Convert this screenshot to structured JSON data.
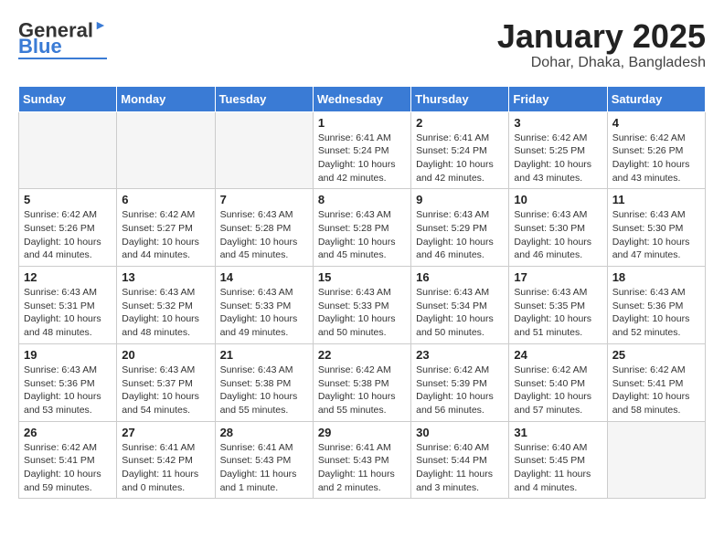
{
  "header": {
    "logo_general": "General",
    "logo_blue": "Blue",
    "month_title": "January 2025",
    "location": "Dohar, Dhaka, Bangladesh"
  },
  "weekdays": [
    "Sunday",
    "Monday",
    "Tuesday",
    "Wednesday",
    "Thursday",
    "Friday",
    "Saturday"
  ],
  "weeks": [
    [
      {
        "day": "",
        "empty": true
      },
      {
        "day": "",
        "empty": true
      },
      {
        "day": "",
        "empty": true
      },
      {
        "day": "1",
        "sunrise": "6:41 AM",
        "sunset": "5:24 PM",
        "daylight": "10 hours and 42 minutes."
      },
      {
        "day": "2",
        "sunrise": "6:41 AM",
        "sunset": "5:24 PM",
        "daylight": "10 hours and 42 minutes."
      },
      {
        "day": "3",
        "sunrise": "6:42 AM",
        "sunset": "5:25 PM",
        "daylight": "10 hours and 43 minutes."
      },
      {
        "day": "4",
        "sunrise": "6:42 AM",
        "sunset": "5:26 PM",
        "daylight": "10 hours and 43 minutes."
      }
    ],
    [
      {
        "day": "5",
        "sunrise": "6:42 AM",
        "sunset": "5:26 PM",
        "daylight": "10 hours and 44 minutes."
      },
      {
        "day": "6",
        "sunrise": "6:42 AM",
        "sunset": "5:27 PM",
        "daylight": "10 hours and 44 minutes."
      },
      {
        "day": "7",
        "sunrise": "6:43 AM",
        "sunset": "5:28 PM",
        "daylight": "10 hours and 45 minutes."
      },
      {
        "day": "8",
        "sunrise": "6:43 AM",
        "sunset": "5:28 PM",
        "daylight": "10 hours and 45 minutes."
      },
      {
        "day": "9",
        "sunrise": "6:43 AM",
        "sunset": "5:29 PM",
        "daylight": "10 hours and 46 minutes."
      },
      {
        "day": "10",
        "sunrise": "6:43 AM",
        "sunset": "5:30 PM",
        "daylight": "10 hours and 46 minutes."
      },
      {
        "day": "11",
        "sunrise": "6:43 AM",
        "sunset": "5:30 PM",
        "daylight": "10 hours and 47 minutes."
      }
    ],
    [
      {
        "day": "12",
        "sunrise": "6:43 AM",
        "sunset": "5:31 PM",
        "daylight": "10 hours and 48 minutes."
      },
      {
        "day": "13",
        "sunrise": "6:43 AM",
        "sunset": "5:32 PM",
        "daylight": "10 hours and 48 minutes."
      },
      {
        "day": "14",
        "sunrise": "6:43 AM",
        "sunset": "5:33 PM",
        "daylight": "10 hours and 49 minutes."
      },
      {
        "day": "15",
        "sunrise": "6:43 AM",
        "sunset": "5:33 PM",
        "daylight": "10 hours and 50 minutes."
      },
      {
        "day": "16",
        "sunrise": "6:43 AM",
        "sunset": "5:34 PM",
        "daylight": "10 hours and 50 minutes."
      },
      {
        "day": "17",
        "sunrise": "6:43 AM",
        "sunset": "5:35 PM",
        "daylight": "10 hours and 51 minutes."
      },
      {
        "day": "18",
        "sunrise": "6:43 AM",
        "sunset": "5:36 PM",
        "daylight": "10 hours and 52 minutes."
      }
    ],
    [
      {
        "day": "19",
        "sunrise": "6:43 AM",
        "sunset": "5:36 PM",
        "daylight": "10 hours and 53 minutes."
      },
      {
        "day": "20",
        "sunrise": "6:43 AM",
        "sunset": "5:37 PM",
        "daylight": "10 hours and 54 minutes."
      },
      {
        "day": "21",
        "sunrise": "6:43 AM",
        "sunset": "5:38 PM",
        "daylight": "10 hours and 55 minutes."
      },
      {
        "day": "22",
        "sunrise": "6:42 AM",
        "sunset": "5:38 PM",
        "daylight": "10 hours and 55 minutes."
      },
      {
        "day": "23",
        "sunrise": "6:42 AM",
        "sunset": "5:39 PM",
        "daylight": "10 hours and 56 minutes."
      },
      {
        "day": "24",
        "sunrise": "6:42 AM",
        "sunset": "5:40 PM",
        "daylight": "10 hours and 57 minutes."
      },
      {
        "day": "25",
        "sunrise": "6:42 AM",
        "sunset": "5:41 PM",
        "daylight": "10 hours and 58 minutes."
      }
    ],
    [
      {
        "day": "26",
        "sunrise": "6:42 AM",
        "sunset": "5:41 PM",
        "daylight": "10 hours and 59 minutes."
      },
      {
        "day": "27",
        "sunrise": "6:41 AM",
        "sunset": "5:42 PM",
        "daylight": "11 hours and 0 minutes."
      },
      {
        "day": "28",
        "sunrise": "6:41 AM",
        "sunset": "5:43 PM",
        "daylight": "11 hours and 1 minute."
      },
      {
        "day": "29",
        "sunrise": "6:41 AM",
        "sunset": "5:43 PM",
        "daylight": "11 hours and 2 minutes."
      },
      {
        "day": "30",
        "sunrise": "6:40 AM",
        "sunset": "5:44 PM",
        "daylight": "11 hours and 3 minutes."
      },
      {
        "day": "31",
        "sunrise": "6:40 AM",
        "sunset": "5:45 PM",
        "daylight": "11 hours and 4 minutes."
      },
      {
        "day": "",
        "empty": true
      }
    ]
  ]
}
